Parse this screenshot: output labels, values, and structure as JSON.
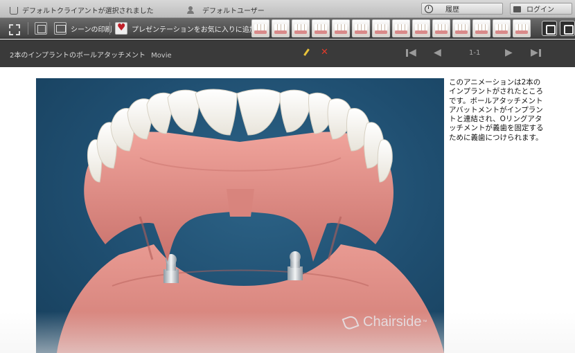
{
  "statusbar": {
    "client_text": "デフォルトクライアントが選択されました",
    "user_text": "デフォルトユーザー",
    "history_label": "履歴",
    "login_label": "ログイン"
  },
  "toolbar": {
    "print_scene_label": "シーンの印刷",
    "favorite_label": "プレゼンテーションをお気に入りに追加",
    "thumbnail_count": 14
  },
  "titlebar": {
    "title": "2本のインプラントのボールアタッチメント",
    "media_type": "Movie",
    "page_indicator": "1-1"
  },
  "video": {
    "watermark": "Chairside",
    "watermark_tm": "™"
  },
  "description": "このアニメーションは2本のインプラントがされたところです。ボールアタッチメントアバットメントがインプラントと連結され、Oリングアタッチメントが義歯を固定するために義歯につけられます。",
  "colors": {
    "toolbar_bg": "#4a4a4a",
    "titlebar_bg": "#3a3a3a",
    "video_bg": "#1f4e70",
    "gum": "#e08e86",
    "tooth": "#f7f5ef",
    "delete_red": "#e23a2a",
    "pencil_yellow": "#e8c23a"
  }
}
